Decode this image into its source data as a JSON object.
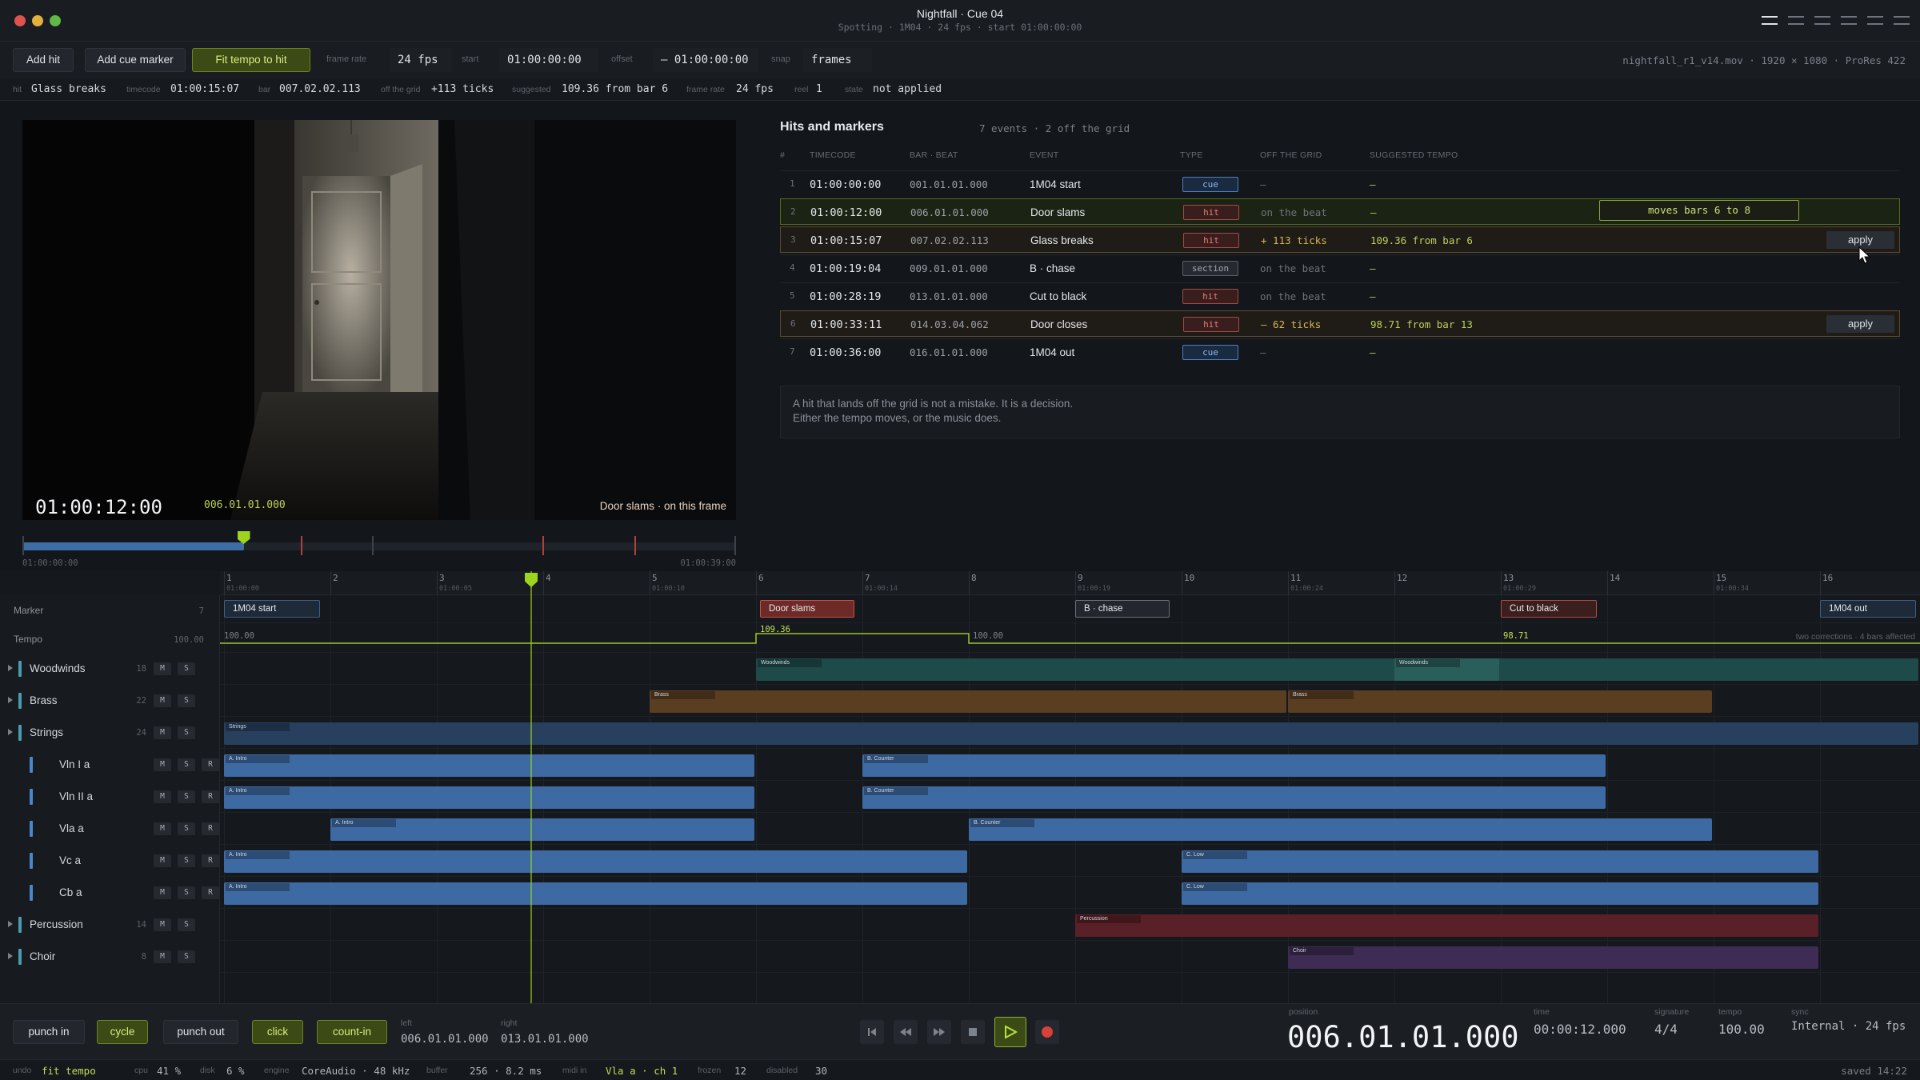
{
  "window": {
    "title": "Nightfall · Cue 04",
    "subtitle": "Spotting · 1M04 · 24 fps · start 01:00:00:00",
    "file": "nightfall_r1_v14.mov · 1920 × 1080 · ProRes 422"
  },
  "toolbar": {
    "add_hit": "Add hit",
    "add_cue_marker": "Add cue marker",
    "fit_tempo": "Fit tempo to hit",
    "frame_rate_label": "frame rate",
    "frame_rate": "24 fps",
    "start_label": "start",
    "start": "01:00:00:00",
    "offset_label": "offset",
    "offset": "– 01:00:00:00",
    "snap_label": "snap",
    "snap": "frames"
  },
  "info": {
    "hit_l": "hit",
    "hit": "Glass breaks",
    "tc_l": "timecode",
    "tc": "01:00:15:07",
    "bar_l": "bar",
    "bar": "007.02.02.113",
    "off_l": "off the grid",
    "off": "+113 ticks",
    "sug_l": "suggested",
    "sug": "109.36 from bar 6",
    "fr_l": "frame rate",
    "fr": "24 fps",
    "reel_l": "reel",
    "reel": "1",
    "state_l": "state",
    "state": "not applied"
  },
  "video": {
    "timecode": "01:00:12:00",
    "barbeat": "006.01.01.000",
    "note": "Door slams · on this frame",
    "scrub_start": "01:00:00:00",
    "scrub_end": "01:00:39:00",
    "progress": 0.31
  },
  "panel": {
    "title": "Hits and markers",
    "summary": "7 events · 2 off the grid",
    "headers": {
      "num": "#",
      "tc": "TIMECODE",
      "bb": "BAR · BEAT",
      "ev": "EVENT",
      "type": "TYPE",
      "og": "OFF THE GRID",
      "sug": "SUGGESTED TEMPO"
    },
    "rows": [
      {
        "n": "1",
        "tc": "01:00:00:00",
        "bb": "001.01.01.000",
        "ev": "1M04 start",
        "type": "cue",
        "og": "–",
        "sug": "–"
      },
      {
        "n": "2",
        "tc": "01:00:12:00",
        "bb": "006.01.01.000",
        "ev": "Door slams",
        "type": "hit",
        "og": "on the beat",
        "sug": "–"
      },
      {
        "n": "3",
        "tc": "01:00:15:07",
        "bb": "007.02.02.113",
        "ev": "Glass breaks",
        "type": "hit",
        "og": "+ 113 ticks",
        "sug": "109.36 from bar 6",
        "btn": "apply"
      },
      {
        "n": "4",
        "tc": "01:00:19:04",
        "bb": "009.01.01.000",
        "ev": "B · chase",
        "type": "section",
        "og": "on the beat",
        "sug": "–"
      },
      {
        "n": "5",
        "tc": "01:00:28:19",
        "bb": "013.01.01.000",
        "ev": "Cut to black",
        "type": "hit",
        "og": "on the beat",
        "sug": "–"
      },
      {
        "n": "6",
        "tc": "01:00:33:11",
        "bb": "014.03.04.062",
        "ev": "Door closes",
        "type": "hit",
        "og": "– 62 ticks",
        "sug": "98.71 from bar 13",
        "btn": "apply"
      },
      {
        "n": "7",
        "tc": "01:00:36:00",
        "bb": "016.01.01.000",
        "ev": "1M04 out",
        "type": "cue",
        "og": "–",
        "sug": "–"
      }
    ],
    "tooltip": "moves bars 6 to 8",
    "note1": "A hit that lands off the grid is not a mistake. It is a decision.",
    "note2": "Either the tempo moves, or the music does."
  },
  "timeline": {
    "bars": [
      "1",
      "2",
      "3",
      "4",
      "5",
      "6",
      "7",
      "8",
      "9",
      "10",
      "11",
      "12",
      "13",
      "14",
      "15",
      "16"
    ],
    "bar_times": [
      "01:00:00",
      "",
      "01:00:05",
      "",
      "01:00:10",
      "",
      "01:00:14",
      "",
      "01:00:19",
      "",
      "01:00:24",
      "",
      "01:00:29",
      "",
      "01:00:34",
      ""
    ],
    "marker_label": "Marker",
    "marker_count": "7",
    "tempo_label": "Tempo",
    "tempo_value": "100.00",
    "markers": [
      {
        "label": "1M04 start",
        "kind": "cue"
      },
      {
        "label": "Door slams",
        "kind": "hit"
      },
      {
        "label": "B · chase",
        "kind": "section"
      },
      {
        "label": "Cut to black",
        "kind": "hit"
      },
      {
        "label": "1M04 out",
        "kind": "cue"
      }
    ],
    "tempo_points": [
      "100.00",
      "109.36",
      "100.00",
      "98.71"
    ],
    "tempo_note": "two corrections · 4 bars affected",
    "tracks": [
      {
        "name": "Woodwinds",
        "count": "18",
        "group": true,
        "color": "#4b9ab0"
      },
      {
        "name": "Brass",
        "count": "22",
        "group": true,
        "color": "#4b9ab0"
      },
      {
        "name": "Strings",
        "count": "24",
        "group": true,
        "color": "#4b9ab0"
      },
      {
        "name": "Vln I a",
        "count": "",
        "group": false,
        "color": "#4a86c8"
      },
      {
        "name": "Vln II a",
        "count": "",
        "group": false,
        "color": "#4a86c8"
      },
      {
        "name": "Vla a",
        "count": "",
        "group": false,
        "color": "#4a86c8"
      },
      {
        "name": "Vc a",
        "count": "",
        "group": false,
        "color": "#4a86c8"
      },
      {
        "name": "Cb a",
        "count": "",
        "group": false,
        "color": "#4a86c8"
      },
      {
        "name": "Percussion",
        "count": "14",
        "group": true,
        "color": "#4b9ab0"
      },
      {
        "name": "Choir",
        "count": "8",
        "group": true,
        "color": "#4b9ab0"
      }
    ],
    "clip_labels": {
      "ww": "Woodwinds",
      "brass": "Brass",
      "str": "Strings",
      "a": "A. Intro",
      "b": "B. Counter",
      "c": "C. Low",
      "perc": "Percussion",
      "choir": "Choir"
    }
  },
  "transport": {
    "punch_in": "punch in",
    "cycle": "cycle",
    "punch_out": "punch out",
    "click": "click",
    "count_in": "count-in",
    "left_l": "left",
    "left": "006.01.01.000",
    "right_l": "right",
    "right": "013.01.01.000",
    "position_l": "position",
    "position": "006.01.01.000",
    "time_l": "time",
    "time": "00:00:12.000",
    "sig_l": "signature",
    "sig": "4/4",
    "tempo_l": "tempo",
    "tempo": "100.00",
    "sync_l": "sync",
    "sync": "Internal · 24 fps"
  },
  "status": {
    "undo_l": "undo",
    "undo": "fit tempo",
    "cpu_l": "cpu",
    "cpu": "41 %",
    "disk_l": "disk",
    "disk": "6 %",
    "engine_l": "engine",
    "engine": "CoreAudio · 48 kHz",
    "buffer_l": "buffer",
    "buffer": "256 · 8.2 ms",
    "midi_l": "midi in",
    "midi": "Vla a · ch 1",
    "frozen_l": "frozen",
    "frozen": "12",
    "disabled_l": "disabled",
    "disabled": "30",
    "saved": "saved 14:22"
  }
}
